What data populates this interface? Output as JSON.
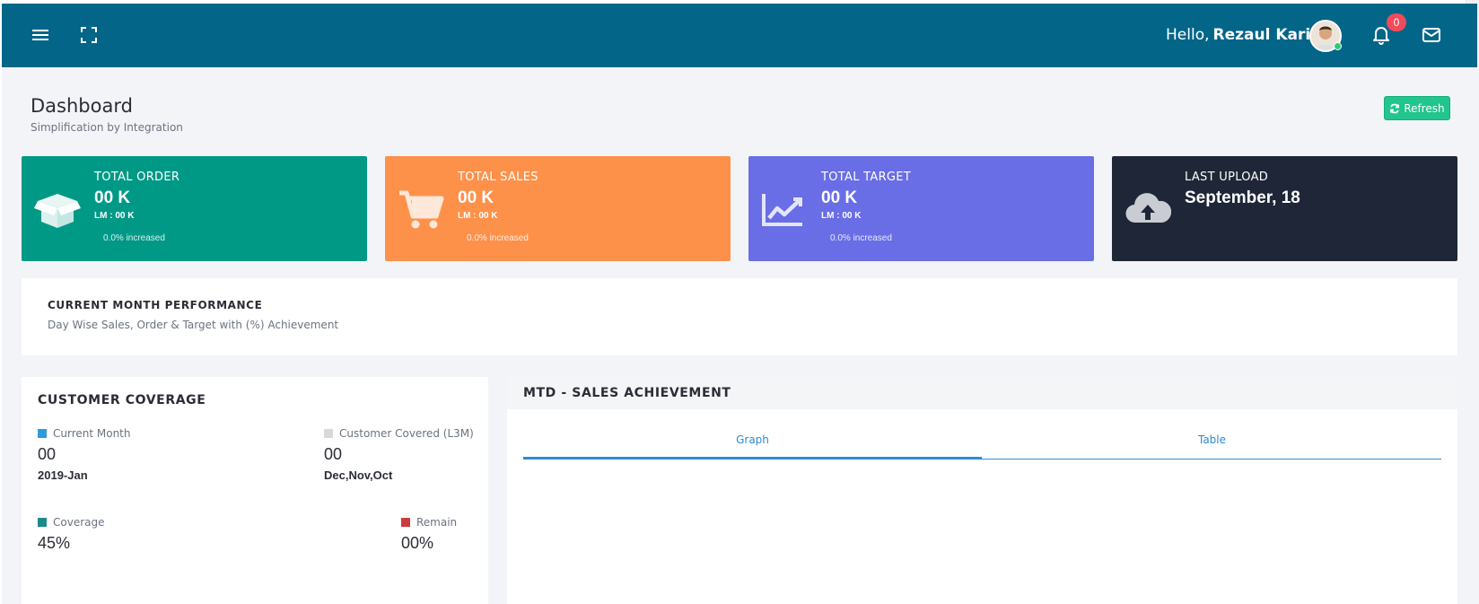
{
  "header": {
    "greeting": "Hello,",
    "user_name": "Rezaul Karim",
    "notification_count": "0"
  },
  "page": {
    "title": "Dashboard",
    "subtitle": "Simplification by Integration",
    "refresh_label": "Refresh"
  },
  "cards": [
    {
      "title": "TOTAL ORDER",
      "value": "00 K",
      "lm": "LM : 00 K",
      "increase": "0.0% increased",
      "color": "#009986",
      "icon": "box-icon"
    },
    {
      "title": "TOTAL SALES",
      "value": "00 K",
      "lm": "LM : 00 K",
      "increase": "0.0% increased",
      "color": "#fe914a",
      "icon": "cart-icon"
    },
    {
      "title": "TOTAL TARGET",
      "value": "00 K",
      "lm": "LM : 00 K",
      "increase": "0.0% increased",
      "color": "#696ee6",
      "icon": "chart-line-icon"
    },
    {
      "title": "LAST UPLOAD",
      "value": "September, 18",
      "color": "#1e2637",
      "icon": "cloud-upload-icon"
    }
  ],
  "performance": {
    "title": "CURRENT MONTH PERFORMANCE",
    "subtitle": "Day Wise Sales, Order & Target with (%) Achievement"
  },
  "coverage": {
    "title": "CUSTOMER COVERAGE",
    "current_month": {
      "label": "Current Month",
      "value": "00",
      "sub": "2019-Jan",
      "color": "#2f9bd8"
    },
    "covered": {
      "label": "Customer Covered (L3M)",
      "value": "00",
      "sub": "Dec,Nov,Oct",
      "color": "#d9d9d9"
    },
    "coverage": {
      "label": "Coverage",
      "value": "45%",
      "color": "#1b8a8a"
    },
    "remain": {
      "label": "Remain",
      "value": "00%",
      "color": "#d03b3b"
    }
  },
  "mtd": {
    "title": "MTD - SALES ACHIEVEMENT",
    "tabs": [
      "Graph",
      "Table"
    ]
  }
}
